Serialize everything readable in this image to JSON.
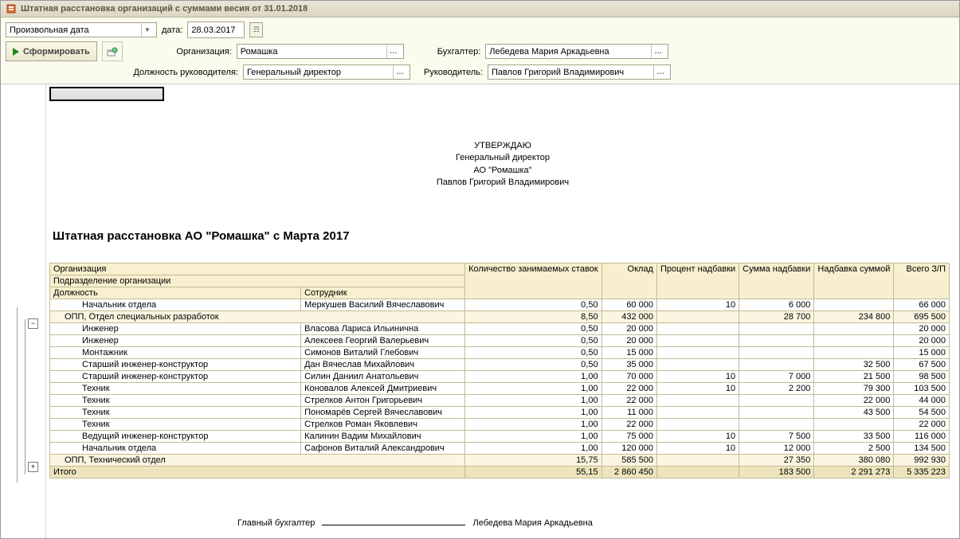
{
  "window_title": "Штатная расстановка организаций с суммами весия от 31.01.2018",
  "toolbar": {
    "date_mode": "Произвольная дата",
    "date_label": "дата:",
    "date_value": "28.03.2017",
    "form_btn": "Сформировать",
    "org_label": "Организация:",
    "org_value": "Ромашка",
    "acc_label": "Бухгалтер:",
    "acc_value": "Лебедева Мария Аркадьевна",
    "pos_label": "Должность руководителя:",
    "pos_value": "Генеральный директор",
    "mgr_label": "Руководитель:",
    "mgr_value": "Павлов Григорий Владимирович"
  },
  "approval": {
    "line1": "УТВЕРЖДАЮ",
    "line2": "Генеральный директор",
    "line3": "АО \"Ромашка\"",
    "line4": "Павлов Григорий Владимирович"
  },
  "report_title": "Штатная расстановка АО \"Ромашка\" с Марта 2017",
  "columns": {
    "org": "Организация",
    "dept": "Подразделение организации",
    "position": "Должность",
    "employee": "Сотрудник",
    "count": "Количество занимаемых ставок",
    "salary": "Оклад",
    "percent": "Процент надбавки",
    "bonus_sum": "Сумма надбавки",
    "bonus_fixed": "Надбавка суммой",
    "total": "Всего З/П"
  },
  "rows": [
    {
      "type": "data",
      "pos": "Начальник отдела",
      "emp": "Меркушев Василий Вячеславович",
      "cnt": "0,50",
      "sal": "60 000",
      "pct": "10",
      "bsum": "6 000",
      "bfix": "",
      "tot": "66 000"
    },
    {
      "type": "sub",
      "pos": "ОПП, Отдел специальных разработок",
      "emp": "",
      "cnt": "8,50",
      "sal": "432 000",
      "pct": "",
      "bsum": "28 700",
      "bfix": "234 800",
      "tot": "695 500"
    },
    {
      "type": "data",
      "pos": "Инженер",
      "emp": "Власова Лариса Ильинична",
      "cnt": "0,50",
      "sal": "20 000",
      "pct": "",
      "bsum": "",
      "bfix": "",
      "tot": "20 000"
    },
    {
      "type": "data",
      "pos": "Инженер",
      "emp": "Алексеев Георгий Валерьевич",
      "cnt": "0,50",
      "sal": "20 000",
      "pct": "",
      "bsum": "",
      "bfix": "",
      "tot": "20 000"
    },
    {
      "type": "data",
      "pos": "Монтажник",
      "emp": "Симонов Виталий Глебович",
      "cnt": "0,50",
      "sal": "15 000",
      "pct": "",
      "bsum": "",
      "bfix": "",
      "tot": "15 000"
    },
    {
      "type": "data",
      "pos": "Старший инженер-конструктор",
      "emp": "Дан Вячеслав Михайлович",
      "cnt": "0,50",
      "sal": "35 000",
      "pct": "",
      "bsum": "",
      "bfix": "32 500",
      "tot": "67 500"
    },
    {
      "type": "data",
      "pos": "Старший инженер-конструктор",
      "emp": "Силин Даниил Анатольевич",
      "cnt": "1,00",
      "sal": "70 000",
      "pct": "10",
      "bsum": "7 000",
      "bfix": "21 500",
      "tot": "98 500"
    },
    {
      "type": "data",
      "pos": "Техник",
      "emp": "Коновалов Алексей Дмитриевич",
      "cnt": "1,00",
      "sal": "22 000",
      "pct": "10",
      "bsum": "2 200",
      "bfix": "79 300",
      "tot": "103 500"
    },
    {
      "type": "data",
      "pos": "Техник",
      "emp": "Стрелков Антон Григорьевич",
      "cnt": "1,00",
      "sal": "22 000",
      "pct": "",
      "bsum": "",
      "bfix": "22 000",
      "tot": "44 000"
    },
    {
      "type": "data",
      "pos": "Техник",
      "emp": "Пономарёв Сергей Вячеславович",
      "cnt": "1,00",
      "sal": "11 000",
      "pct": "",
      "bsum": "",
      "bfix": "43 500",
      "tot": "54 500"
    },
    {
      "type": "data",
      "pos": "Техник",
      "emp": "Стрелков Роман Яковлевич",
      "cnt": "1,00",
      "sal": "22 000",
      "pct": "",
      "bsum": "",
      "bfix": "",
      "tot": "22 000"
    },
    {
      "type": "data",
      "pos": "Ведущий инженер-конструктор",
      "emp": "Калинин Вадим Михайлович",
      "cnt": "1,00",
      "sal": "75 000",
      "pct": "10",
      "bsum": "7 500",
      "bfix": "33 500",
      "tot": "116 000"
    },
    {
      "type": "data",
      "pos": "Начальник отдела",
      "emp": "Сафонов Виталий Александрович",
      "cnt": "1,00",
      "sal": "120 000",
      "pct": "10",
      "bsum": "12 000",
      "bfix": "2 500",
      "tot": "134 500"
    },
    {
      "type": "sub",
      "pos": "ОПП, Технический отдел",
      "emp": "",
      "cnt": "15,75",
      "sal": "585 500",
      "pct": "",
      "bsum": "27 350",
      "bfix": "380 080",
      "tot": "992 930"
    }
  ],
  "total_row": {
    "label": "Итого",
    "cnt": "55,15",
    "sal": "2 860 450",
    "pct": "",
    "bsum": "183 500",
    "bfix": "2 291 273",
    "tot": "5 335 223"
  },
  "signature": {
    "role": "Главный бухгалтер",
    "name": "Лебедева Мария Аркадьевна"
  }
}
